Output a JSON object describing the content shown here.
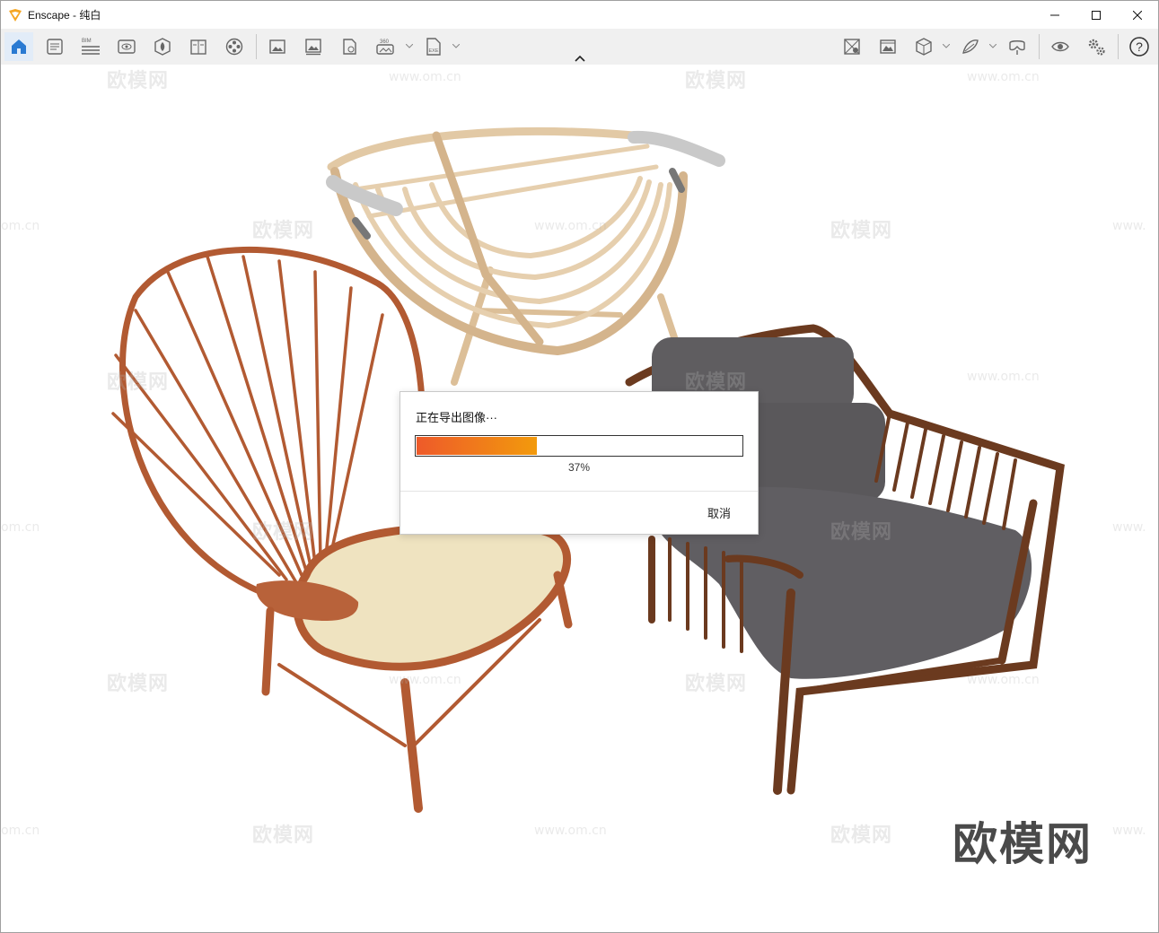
{
  "window": {
    "title": "Enscape - 纯白",
    "app_name": "Enscape"
  },
  "toolbar": {
    "bim_label": "BIM",
    "panorama_label": "360",
    "exe_label": "EXE",
    "left_icons": [
      "home-icon",
      "project-info-icon",
      "bim-icon",
      "view-icon",
      "asset-library-icon",
      "material-icon",
      "video-icon",
      "screenshot-icon",
      "batch-render-icon",
      "upload-icon",
      "panorama-icon",
      "exe-export-icon"
    ],
    "right_icons": [
      "atmosphere-icon",
      "visual-settings-icon",
      "cube-icon",
      "material-editor-icon",
      "vr-headset-icon",
      "visibility-icon",
      "settings-icon",
      "help-icon"
    ],
    "help_label": "?"
  },
  "dialog": {
    "title": "正在导出图像···",
    "progress_percent": 37,
    "progress_label": "37%",
    "cancel_label": "取消"
  },
  "watermark": {
    "brand": "欧模网",
    "url": "www.om.cn",
    "url_fragment": "om.cn",
    "url_fragment_right": "www."
  },
  "colors": {
    "progress_start": "#ee5a2a",
    "progress_end": "#f29a0c",
    "toolbar_bg": "#f0f0f0",
    "accent": "#2a7ad2"
  }
}
